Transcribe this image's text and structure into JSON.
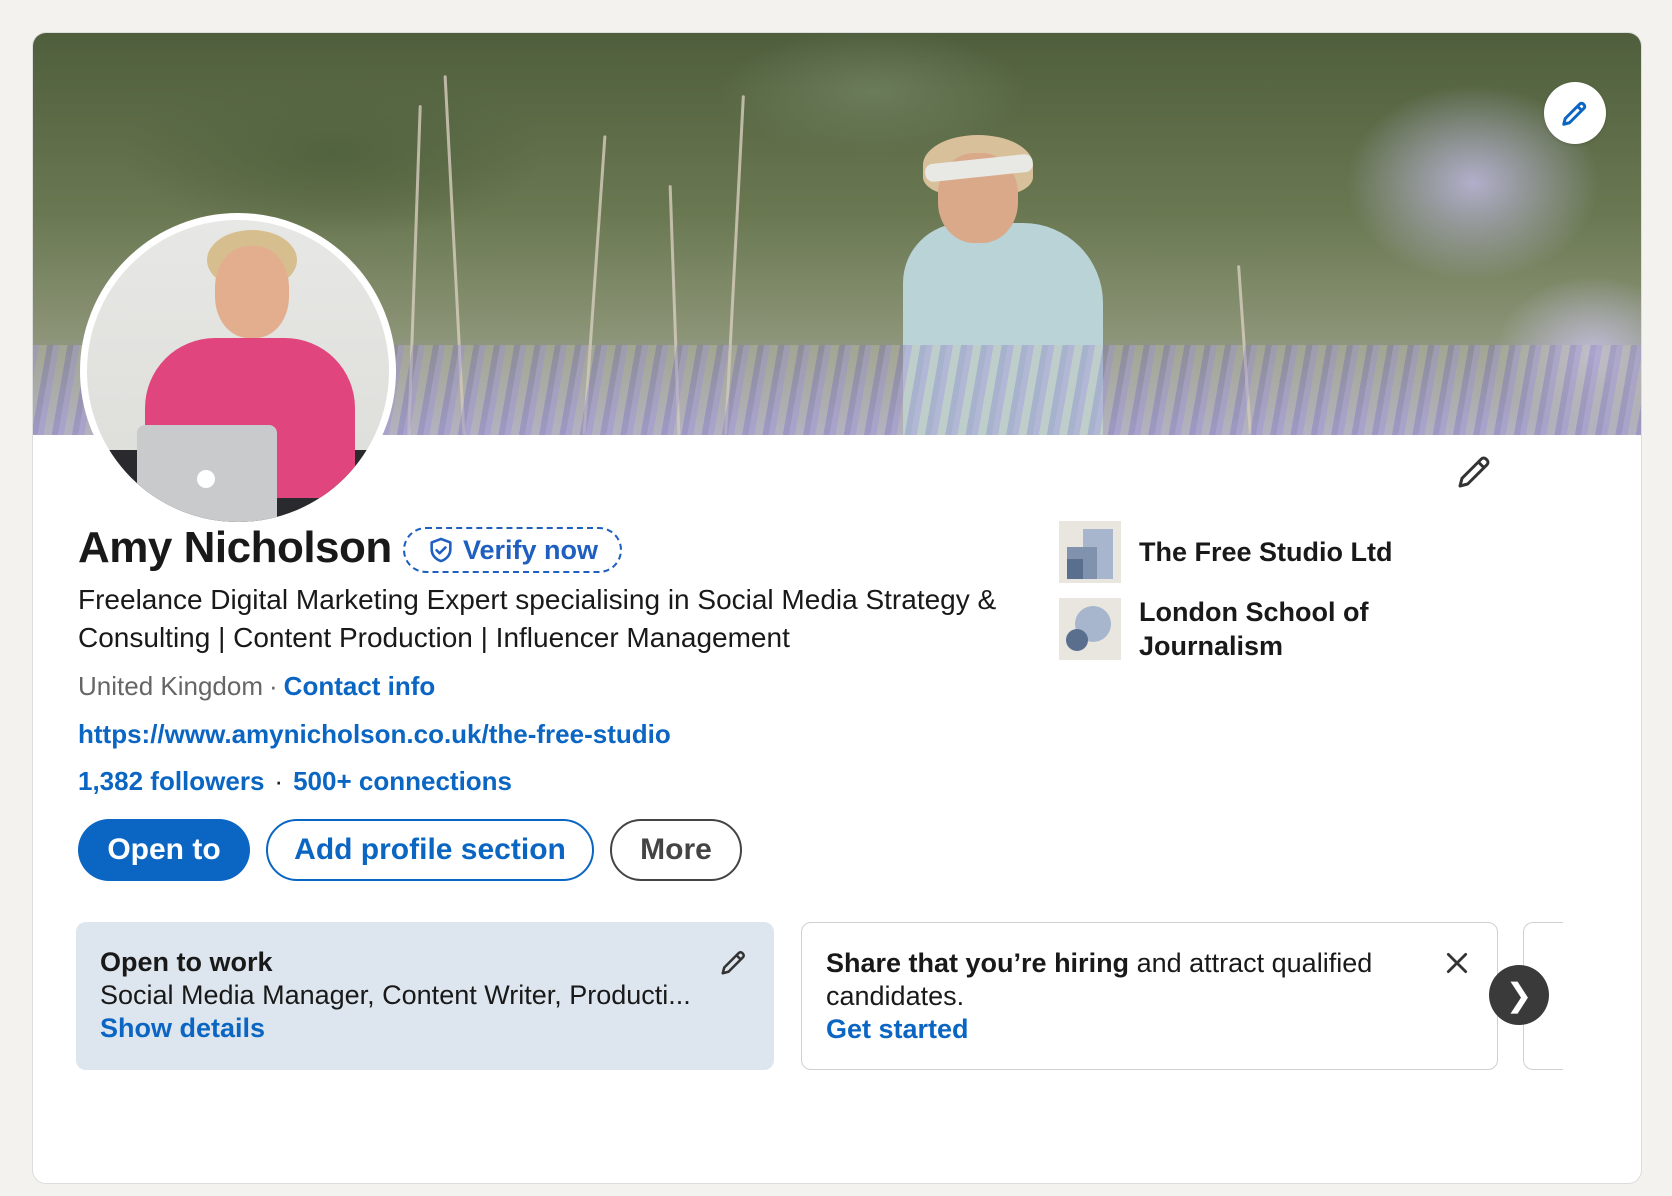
{
  "profile": {
    "name": "Amy Nicholson",
    "verify_label": "Verify now",
    "headline": "Freelance Digital Marketing Expert specialising in Social Media Strategy & Consulting | Content Production | Influencer Management",
    "location": "United Kingdom",
    "separator": "·",
    "contact_info": "Contact info",
    "website": "https://www.amynicholson.co.uk/the-free-studio",
    "followers": "1,382 followers",
    "connections": "500+ connections"
  },
  "actions": {
    "open_to": "Open to",
    "add_section": "Add profile section",
    "more": "More"
  },
  "organizations": [
    {
      "name": "The Free Studio Ltd",
      "icon": "company-logo-placeholder"
    },
    {
      "name": "London School of Journalism",
      "icon": "school-logo-placeholder"
    }
  ],
  "features": {
    "open_to_work": {
      "title": "Open to work",
      "roles": "Social Media Manager, Content Writer, Producti...",
      "action": "Show details"
    },
    "hiring": {
      "title": "Share that you’re hiring",
      "text": " and attract qualified candidates.",
      "action": "Get started"
    }
  },
  "icons": {
    "banner_edit": "pencil-icon",
    "intro_edit": "pencil-icon",
    "verify": "shield-check-icon",
    "close": "close-icon",
    "next": "chevron-right-icon",
    "next_glyph": "❯"
  },
  "colors": {
    "accent": "#0a66c2",
    "open_to_work_bg": "#dde5ee",
    "page_bg": "#f3f2ef"
  }
}
